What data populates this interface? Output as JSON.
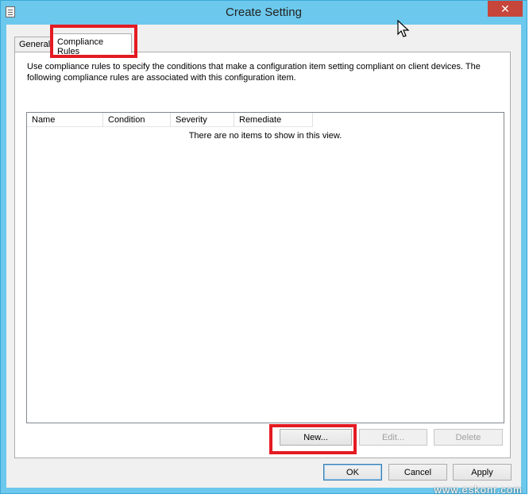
{
  "window": {
    "title": "Create Setting",
    "close_symbol": "✕"
  },
  "tabs": [
    {
      "label": "General",
      "active": false
    },
    {
      "label": "Compliance Rules",
      "active": true
    }
  ],
  "panel": {
    "description": "Use compliance rules to specify the conditions that make a configuration item setting compliant on client devices. The following compliance rules are associated with this configuration item."
  },
  "list": {
    "columns": [
      "Name",
      "Condition",
      "Severity",
      "Remediate"
    ],
    "empty_message": "There are no items to show in this view."
  },
  "list_buttons": {
    "new": "New...",
    "edit": "Edit...",
    "delete": "Delete"
  },
  "dialog_buttons": {
    "ok": "OK",
    "cancel": "Cancel",
    "apply": "Apply"
  },
  "watermark": "www.eskonr.com",
  "colors": {
    "title_bar": "#6cc8ec",
    "close_button": "#c7463b",
    "highlight": "#e41b23"
  },
  "icons": {
    "app": "document-icon",
    "cursor": "mouse-pointer-icon"
  }
}
